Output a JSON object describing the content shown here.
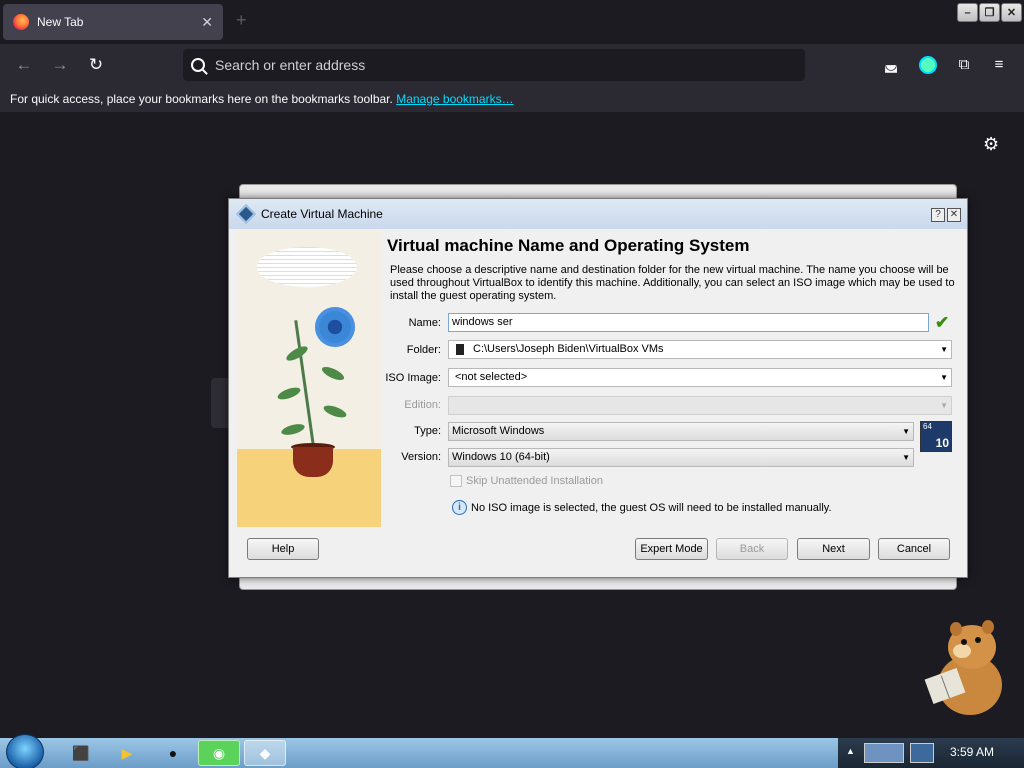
{
  "browser": {
    "tab_title": "New Tab",
    "address_placeholder": "Search or enter address",
    "bookmarks_text": "For quick access, place your bookmarks here on the bookmarks toolbar.",
    "bookmarks_link": "Manage bookmarks…"
  },
  "dialog": {
    "title": "Create Virtual Machine",
    "heading": "Virtual machine Name and Operating System",
    "description": "Please choose a descriptive name and destination folder for the new virtual machine. The name you choose will be used throughout VirtualBox to identify this machine. Additionally, you can select an ISO image which may be used to install the guest operating system.",
    "name_label": "Name:",
    "name_value": "windows ser",
    "folder_label": "Folder:",
    "folder_value": "C:\\Users\\Joseph Biden\\VirtualBox VMs",
    "iso_label": "ISO Image:",
    "iso_value": "<not selected>",
    "edition_label": "Edition:",
    "edition_value": "",
    "type_label": "Type:",
    "type_value": "Microsoft Windows",
    "version_label": "Version:",
    "version_value": "Windows 10 (64-bit)",
    "os_badge_top": "64",
    "os_badge_num": "10",
    "skip_label": "Skip Unattended Installation",
    "info_text": "No ISO image is selected, the guest OS will need to be installed manually.",
    "buttons": {
      "help": "Help",
      "expert": "Expert Mode",
      "back": "Back",
      "next": "Next",
      "cancel": "Cancel"
    }
  },
  "taskbar": {
    "clock": "3:59 AM"
  }
}
